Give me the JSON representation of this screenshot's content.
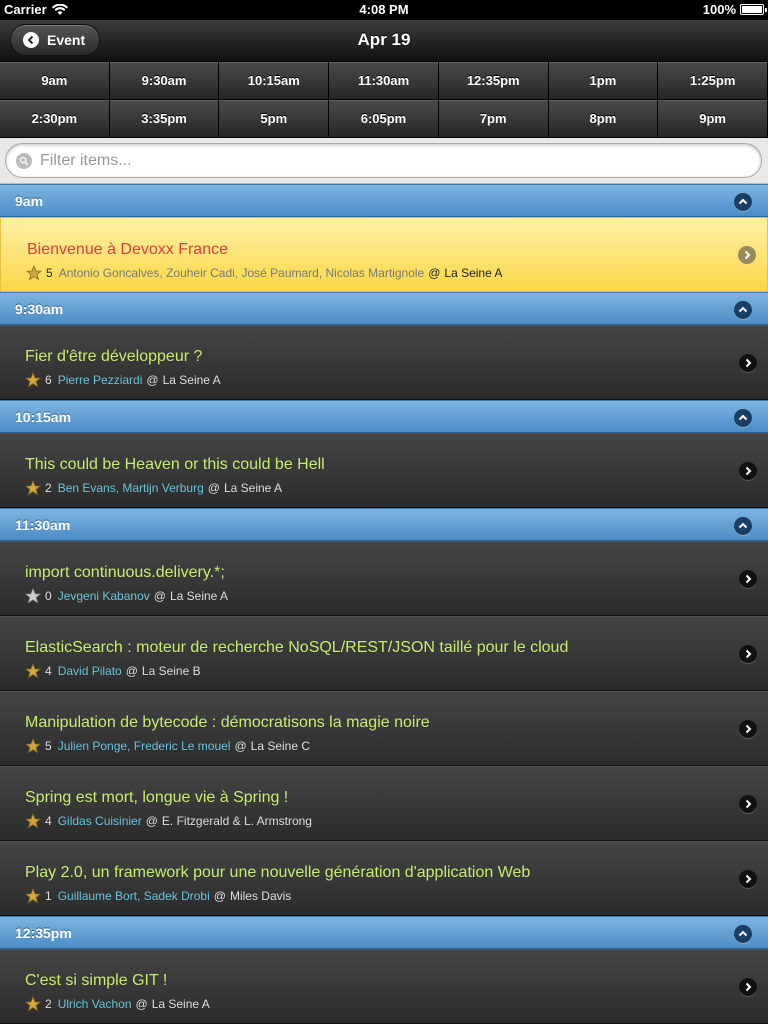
{
  "status": {
    "carrier": "Carrier",
    "time": "4:08 PM",
    "battery": "100%",
    "battery_level": 1.0
  },
  "header": {
    "back_label": "Event",
    "title": "Apr 19"
  },
  "times": [
    "9am",
    "9:30am",
    "10:15am",
    "11:30am",
    "12:35pm",
    "1pm",
    "1:25pm",
    "2:30pm",
    "3:35pm",
    "5pm",
    "6:05pm",
    "7pm",
    "8pm",
    "9pm"
  ],
  "search": {
    "placeholder": "Filter items...",
    "value": ""
  },
  "colors": {
    "divider": "#4a8cc7",
    "title": "#c7ec6d",
    "speaker": "#67c3d9",
    "active_title": "#d3423e",
    "active_bg": "#fad845"
  },
  "sections": [
    {
      "time": "9am",
      "items": [
        {
          "title": "Bienvenue à Devoxx France",
          "count": "5",
          "speakers": "Antonio Goncalves, Zouheir Cadi, José Paumard, Nicolas Martignole",
          "at": "@",
          "room": "La Seine A",
          "active": true
        }
      ]
    },
    {
      "time": "9:30am",
      "items": [
        {
          "title": "Fier d'être développeur ?",
          "count": "6",
          "speakers": "Pierre Pezziardi",
          "at": "@",
          "room": "La Seine A"
        }
      ]
    },
    {
      "time": "10:15am",
      "items": [
        {
          "title": "This could be Heaven or this could be Hell",
          "count": "2",
          "speakers": "Ben Evans, Martijn Verburg",
          "at": "@",
          "room": "La Seine A"
        }
      ]
    },
    {
      "time": "11:30am",
      "items": [
        {
          "title": "import continuous.delivery.*;",
          "count": "0",
          "speakers": "Jevgeni Kabanov",
          "at": "@",
          "room": "La Seine A",
          "grey_star": true
        },
        {
          "title": "ElasticSearch : moteur de recherche NoSQL/REST/JSON taillé pour le cloud",
          "count": "4",
          "speakers": "David Pilato",
          "at": "@",
          "room": "La Seine B"
        },
        {
          "title": "Manipulation de bytecode : démocratisons la magie noire",
          "count": "5",
          "speakers": "Julien Ponge, Frederic Le mouel",
          "at": "@",
          "room": "La Seine C"
        },
        {
          "title": "Spring est mort, longue vie à Spring !",
          "count": "4",
          "speakers": "Gildas Cuisinier",
          "at": "@",
          "room": "E. Fitzgerald & L. Armstrong"
        },
        {
          "title": "Play 2.0, un framework pour une nouvelle génération d'application Web",
          "count": "1",
          "speakers": "Guillaume Bort, Sadek Drobi",
          "at": "@",
          "room": "Miles Davis"
        }
      ]
    },
    {
      "time": "12:35pm",
      "items": [
        {
          "title": "C'est si simple GIT !",
          "count": "2",
          "speakers": "Ulrich Vachon",
          "at": "@",
          "room": "La Seine A"
        }
      ]
    }
  ]
}
